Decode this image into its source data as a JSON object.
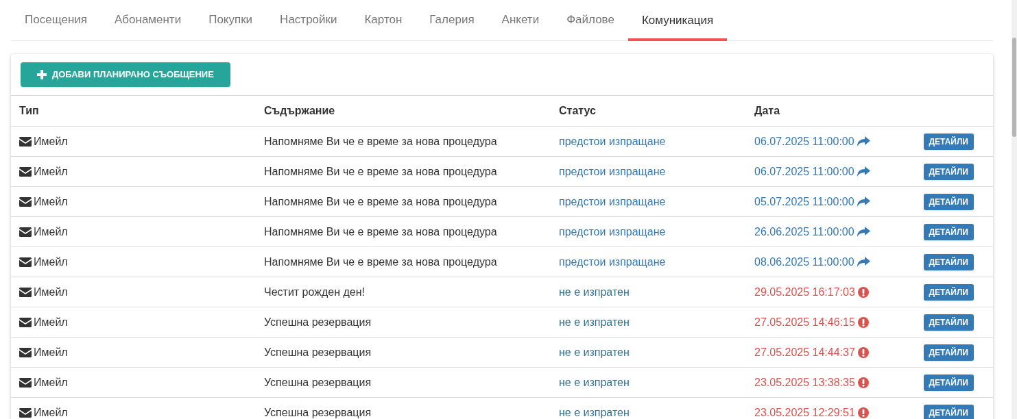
{
  "tabs": [
    {
      "label": "Посещения",
      "selected": false
    },
    {
      "label": "Абонаменти",
      "selected": false
    },
    {
      "label": "Покупки",
      "selected": false
    },
    {
      "label": "Настройки",
      "selected": false
    },
    {
      "label": "Картон",
      "selected": false
    },
    {
      "label": "Галерия",
      "selected": false
    },
    {
      "label": "Анкети",
      "selected": false
    },
    {
      "label": "Файлове",
      "selected": false
    },
    {
      "label": "Комуникация",
      "selected": true
    }
  ],
  "add_button": "ДОБАВИ ПЛАНИРАНО СЪОБЩЕНИЕ",
  "table": {
    "columns": [
      "Тип",
      "Съдържание",
      "Статус",
      "Дата"
    ],
    "rows": [
      {
        "kind": "scheduled",
        "type": "Имейл",
        "content": "Напомняме Ви че е време за нова процедура",
        "status": "предстои изпращане",
        "date": "06.07.2025 11:00:00",
        "action": "ДЕТАЙЛИ"
      },
      {
        "kind": "scheduled",
        "type": "Имейл",
        "content": "Напомняме Ви че е време за нова процедура",
        "status": "предстои изпращане",
        "date": "06.07.2025 11:00:00",
        "action": "ДЕТАЙЛИ"
      },
      {
        "kind": "scheduled",
        "type": "Имейл",
        "content": "Напомняме Ви че е време за нова процедура",
        "status": "предстои изпращане",
        "date": "05.07.2025 11:00:00",
        "action": "ДЕТАЙЛИ"
      },
      {
        "kind": "scheduled",
        "type": "Имейл",
        "content": "Напомняме Ви че е време за нова процедура",
        "status": "предстои изпращане",
        "date": "26.06.2025 11:00:00",
        "action": "ДЕТАЙЛИ"
      },
      {
        "kind": "scheduled",
        "type": "Имейл",
        "content": "Напомняме Ви че е време за нова процедура",
        "status": "предстои изпращане",
        "date": "08.06.2025 11:00:00",
        "action": "ДЕТАЙЛИ"
      },
      {
        "kind": "failed",
        "type": "Имейл",
        "content": "Честит рожден ден!",
        "status": "не е изпратен",
        "date": "29.05.2025 16:17:03",
        "action": "ДЕТАЙЛИ"
      },
      {
        "kind": "failed",
        "type": "Имейл",
        "content": "Успешна резервация",
        "status": "не е изпратен",
        "date": "27.05.2025 14:46:15",
        "action": "ДЕТАЙЛИ"
      },
      {
        "kind": "failed",
        "type": "Имейл",
        "content": "Успешна резервация",
        "status": "не е изпратен",
        "date": "27.05.2025 14:44:37",
        "action": "ДЕТАЙЛИ"
      },
      {
        "kind": "failed",
        "type": "Имейл",
        "content": "Успешна резервация",
        "status": "не е изпратен",
        "date": "23.05.2025 13:38:35",
        "action": "ДЕТАЙЛИ"
      },
      {
        "kind": "failed",
        "type": "Имейл",
        "content": "Успешна резервация",
        "status": "не е изпратен",
        "date": "23.05.2025 12:29:51",
        "action": "ДЕТАЙЛИ"
      }
    ]
  }
}
